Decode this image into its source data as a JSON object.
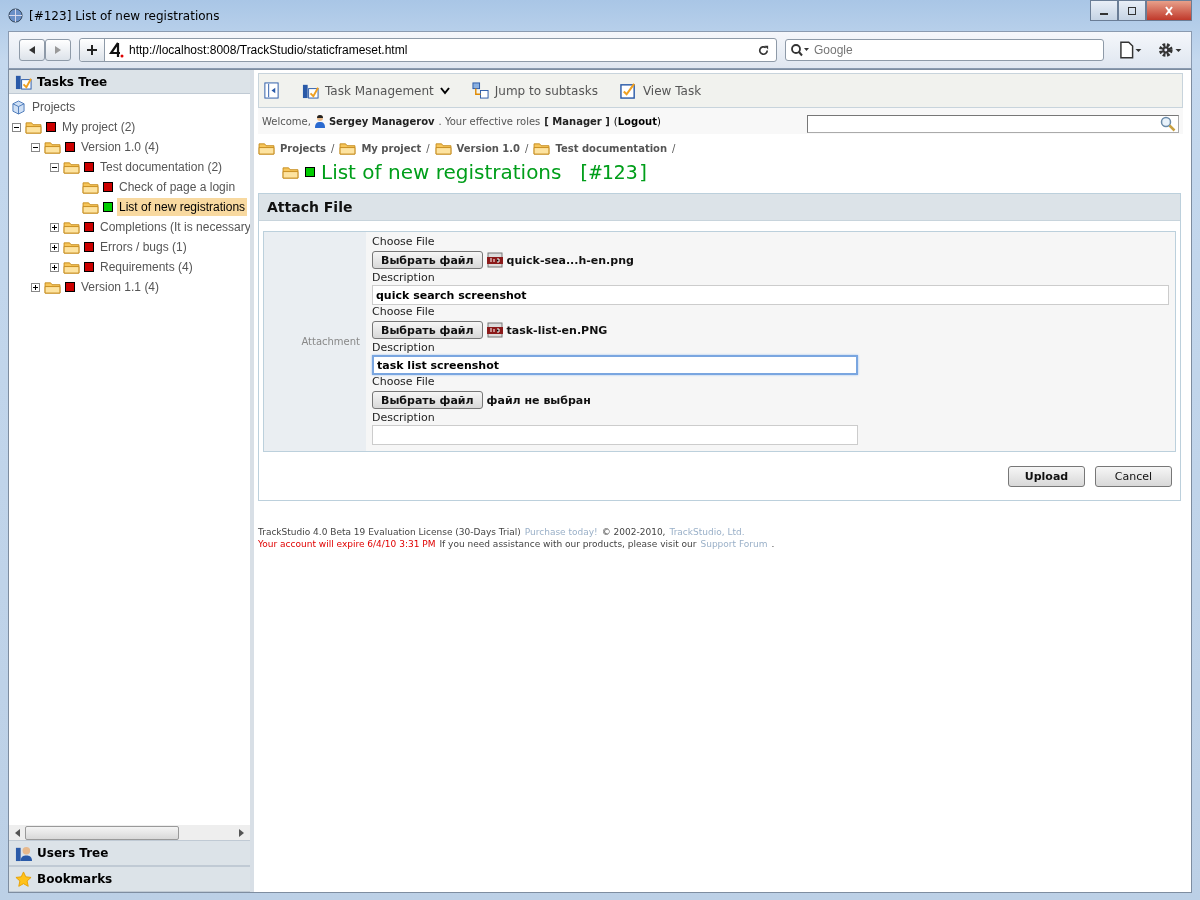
{
  "window": {
    "title": "[#123] List of new registrations"
  },
  "browser": {
    "url": "http://localhost:8008/TrackStudio/staticframeset.html",
    "search_placeholder": "Google"
  },
  "sidebar": {
    "title": "Tasks Tree",
    "root": "Projects",
    "tree": [
      {
        "label": "My project (2)",
        "color": "#cc0000",
        "expanded": true,
        "selected": false,
        "children": [
          {
            "label": "Version 1.0 (4)",
            "color": "#cc0000",
            "expanded": true,
            "selected": false,
            "children": [
              {
                "label": "Test documentation (2)",
                "color": "#cc0000",
                "expanded": true,
                "selected": false,
                "children": [
                  {
                    "label": "Check of page a login",
                    "color": "#cc0000",
                    "selected": false
                  },
                  {
                    "label": "List of new registrations",
                    "color": "#00cc00",
                    "selected": true
                  }
                ]
              },
              {
                "label": "Completions (It is necessary",
                "color": "#cc0000",
                "expanded": false,
                "selected": false
              },
              {
                "label": "Errors / bugs (1)",
                "color": "#cc0000",
                "expanded": false,
                "selected": false
              },
              {
                "label": "Requirements (4)",
                "color": "#cc0000",
                "expanded": false,
                "selected": false
              }
            ]
          },
          {
            "label": "Version 1.1 (4)",
            "color": "#cc0000",
            "expanded": false,
            "selected": false
          }
        ]
      }
    ],
    "panels": [
      {
        "label": "Users Tree",
        "kind": "users"
      },
      {
        "label": "Bookmarks",
        "kind": "star"
      }
    ]
  },
  "toolbar": [
    {
      "label": "Task Management",
      "kind": "manage"
    },
    {
      "label": "Jump to subtasks",
      "kind": "jump"
    },
    {
      "label": "View Task",
      "kind": "view"
    }
  ],
  "welcome": {
    "prefix": "Welcome,",
    "user": "Sergey Managerov",
    "middle": ". Your effective roles",
    "roles": "[ Manager ]",
    "logout": "(**Logout**)"
  },
  "breadcrumbs": [
    {
      "label": "Projects",
      "sep": "/"
    },
    {
      "label": "My project",
      "sep": "/"
    },
    {
      "label": "Version 1.0",
      "sep": "/"
    },
    {
      "label": "Test documentation",
      "sep": "/"
    }
  ],
  "task": {
    "title": "List of new registrations",
    "number": "[#123]",
    "color": "#00cc00"
  },
  "form": {
    "title": "Attach File",
    "label": "Attachment",
    "rows": [
      {
        "choose_label": "Choose File",
        "button": "Выбрать файл",
        "kind": "file",
        "file": "quick-sea...h-en.png",
        "desc_label": "Description",
        "value": "quick search screenshot",
        "focused": false,
        "wide": true
      },
      {
        "choose_label": "Choose File",
        "button": "Выбрать файл",
        "kind": "file",
        "file": "task-list-en.PNG",
        "desc_label": "Description",
        "value": "task list screenshot",
        "focused": true,
        "wide": false
      },
      {
        "choose_label": "Choose File",
        "button": "Выбрать файл",
        "kind": "none",
        "file": "файл не выбран",
        "desc_label": "Description",
        "focused": false,
        "wide": false
      }
    ],
    "buttons": [
      {
        "label": "Upload",
        "kind": "primary"
      },
      {
        "label": "Cancel",
        "kind": "normal"
      }
    ]
  },
  "footer": [
    [
      {
        "text": "TrackStudio 4.0 Beta 19 Evaluation License (30-Days Trial)",
        "kind": "text"
      },
      {
        "text": "Purchase today!",
        "kind": "link"
      },
      {
        "text": "© 2002-2010,",
        "kind": "text"
      },
      {
        "text": "TrackStudio, Ltd.",
        "kind": "link"
      }
    ],
    [
      {
        "text": "Your account will expire 6/4/10 3:31 PM",
        "kind": "warning"
      },
      {
        "text": "If you need assistance with our products, please visit our",
        "kind": "text"
      },
      {
        "text": "Support Forum",
        "kind": "link"
      },
      {
        "text": ".",
        "kind": "text"
      }
    ]
  ]
}
